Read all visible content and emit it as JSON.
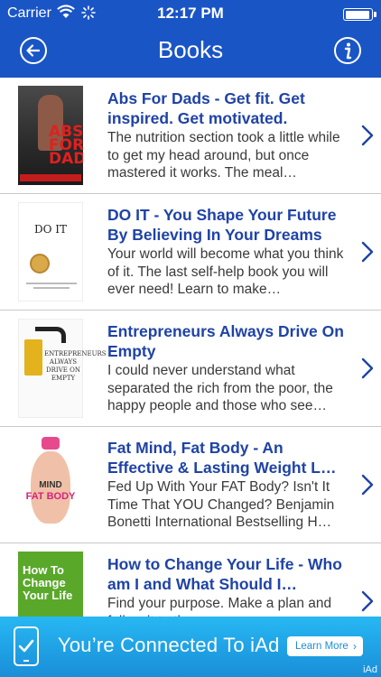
{
  "status_bar": {
    "carrier": "Carrier",
    "time": "12:17 PM",
    "battery_level": 0.95
  },
  "nav": {
    "title": "Books",
    "back_icon": "back-arrow-circle-icon",
    "info_icon": "info-circle-icon"
  },
  "books": [
    {
      "title": "Abs For Dads - Get fit. Get inspired. Get motivated.",
      "description": "The nutrition section took a little while to get my head around, but once mastered it works. The meal…",
      "cover": {
        "text_1": "ABS",
        "text_2": "FOR",
        "text_3": "DADS"
      }
    },
    {
      "title": "DO IT - You Shape Your Future By Believing In Your Dreams",
      "description": "Your world will become what you think of it. The last self-help book you will ever need! Learn to make…",
      "cover": {
        "text_1": "DO IT"
      }
    },
    {
      "title": "Entrepreneurs Always Drive On Empty",
      "description": "I could never understand what separated the rich from the poor, the happy people and those who see…",
      "cover": {
        "text_1": "ENTREPRENEURS ALWAYS DRIVE ON EMPTY"
      }
    },
    {
      "title": "Fat Mind, Fat Body - An Effective & Lasting Weight L…",
      "description": "Fed Up With Your FAT Body? Isn't It Time That YOU Changed? Benjamin Bonetti International Bestselling H…",
      "cover": {
        "text_1": "MIND",
        "text_2": "FAT BODY"
      }
    },
    {
      "title": "How to Change Your Life - Who am I and What Should I…",
      "description": "Find your purpose. Make a plan and follow it to the…",
      "cover": {
        "text_1": "How To Change Your Life"
      }
    }
  ],
  "ad": {
    "text": "You’re Connected To iAd",
    "button_label": "Learn More",
    "brand": "iAd"
  },
  "colors": {
    "nav_bg": "#1a55c6",
    "title_blue": "#1f43a6",
    "ad_bg": "#1a8ed8"
  }
}
